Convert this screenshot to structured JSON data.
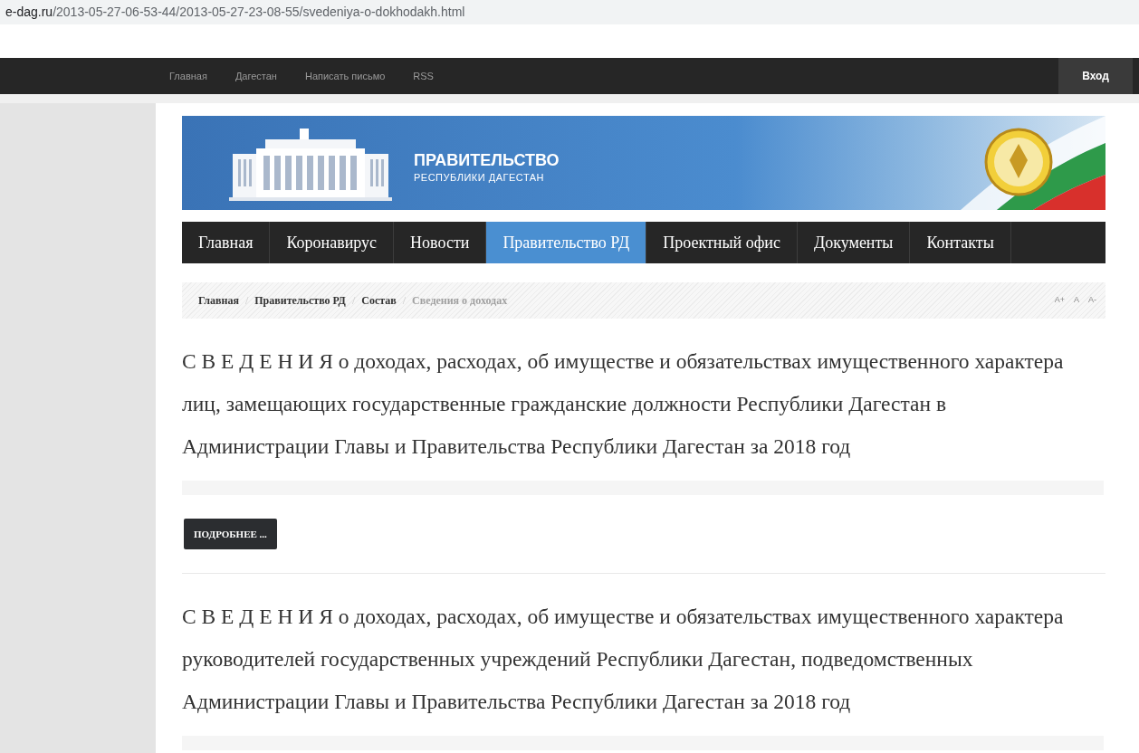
{
  "address_bar": {
    "domain": "e-dag.ru",
    "path": "/2013-05-27-06-53-44/2013-05-27-23-08-55/svedeniya-o-dokhodakh.html"
  },
  "top_nav": {
    "links": [
      "Главная",
      "Дагестан",
      "Написать письмо",
      "RSS"
    ],
    "login": "Вход"
  },
  "banner": {
    "title": "ПРАВИТЕЛЬСТВО",
    "subtitle": "РЕСПУБЛИКИ ДАГЕСТАН"
  },
  "main_menu": [
    {
      "label": "Главная",
      "selected": false
    },
    {
      "label": "Коронавирус",
      "selected": false
    },
    {
      "label": "Новости",
      "selected": false
    },
    {
      "label": "Правительство РД",
      "selected": true
    },
    {
      "label": "Проектный офис",
      "selected": false
    },
    {
      "label": "Документы",
      "selected": false
    },
    {
      "label": "Контакты",
      "selected": false
    }
  ],
  "breadcrumbs": [
    {
      "label": "Главная",
      "selected": false
    },
    {
      "label": "Правительство РД",
      "selected": false
    },
    {
      "label": "Состав",
      "selected": false
    },
    {
      "label": "Сведения о доходах",
      "selected": true
    }
  ],
  "breadcrumb_separator": "/",
  "font_size_controls": [
    "A+",
    "A",
    "A-"
  ],
  "articles": [
    {
      "title": "С В Е Д Е Н И Я о доходах, расходах, об имуществе и обязательствах имущественного характера лиц, замещающих государственные гражданские должности Республики Дагестан в Администрации Главы и Правительства Республики Дагестан за 2018 год",
      "button": "ПОДРОБНЕЕ ..."
    },
    {
      "title": "С В Е Д Е Н И Я о доходах, расходах, об имуществе и обязательствах имущественного характера руководителей государственных учреждений Республики Дагестан, подведомственных Администрации Главы и Правительства Республики Дагестан за 2018 год"
    }
  ]
}
